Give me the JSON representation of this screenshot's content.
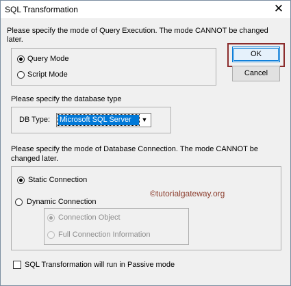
{
  "window": {
    "title": "SQL Transformation",
    "close_glyph": "✕"
  },
  "query_execution": {
    "prompt": "Please specify the mode of Query Execution. The mode CANNOT be changed later.",
    "options": [
      {
        "label": "Query Mode",
        "checked": true
      },
      {
        "label": "Script Mode",
        "checked": false
      }
    ]
  },
  "buttons": {
    "ok_label": "OK",
    "cancel_label": "Cancel"
  },
  "database_type": {
    "prompt": "Please specify the database type",
    "label": "DB Type:",
    "selected": "Microsoft SQL Server",
    "arrow_glyph": "▼"
  },
  "db_connection": {
    "prompt": "Please specify the mode of Database Connection. The mode CANNOT be changed later.",
    "static_label": "Static Connection",
    "dynamic_label": "Dynamic Connection",
    "sub_options": [
      {
        "label": "Connection Object",
        "checked": true,
        "enabled": false
      },
      {
        "label": "Full Connection Information",
        "checked": false,
        "enabled": false
      }
    ]
  },
  "passive": {
    "label": "SQL Transformation will run in Passive mode",
    "checked": false
  },
  "watermark": "©tutorialgateway.org"
}
